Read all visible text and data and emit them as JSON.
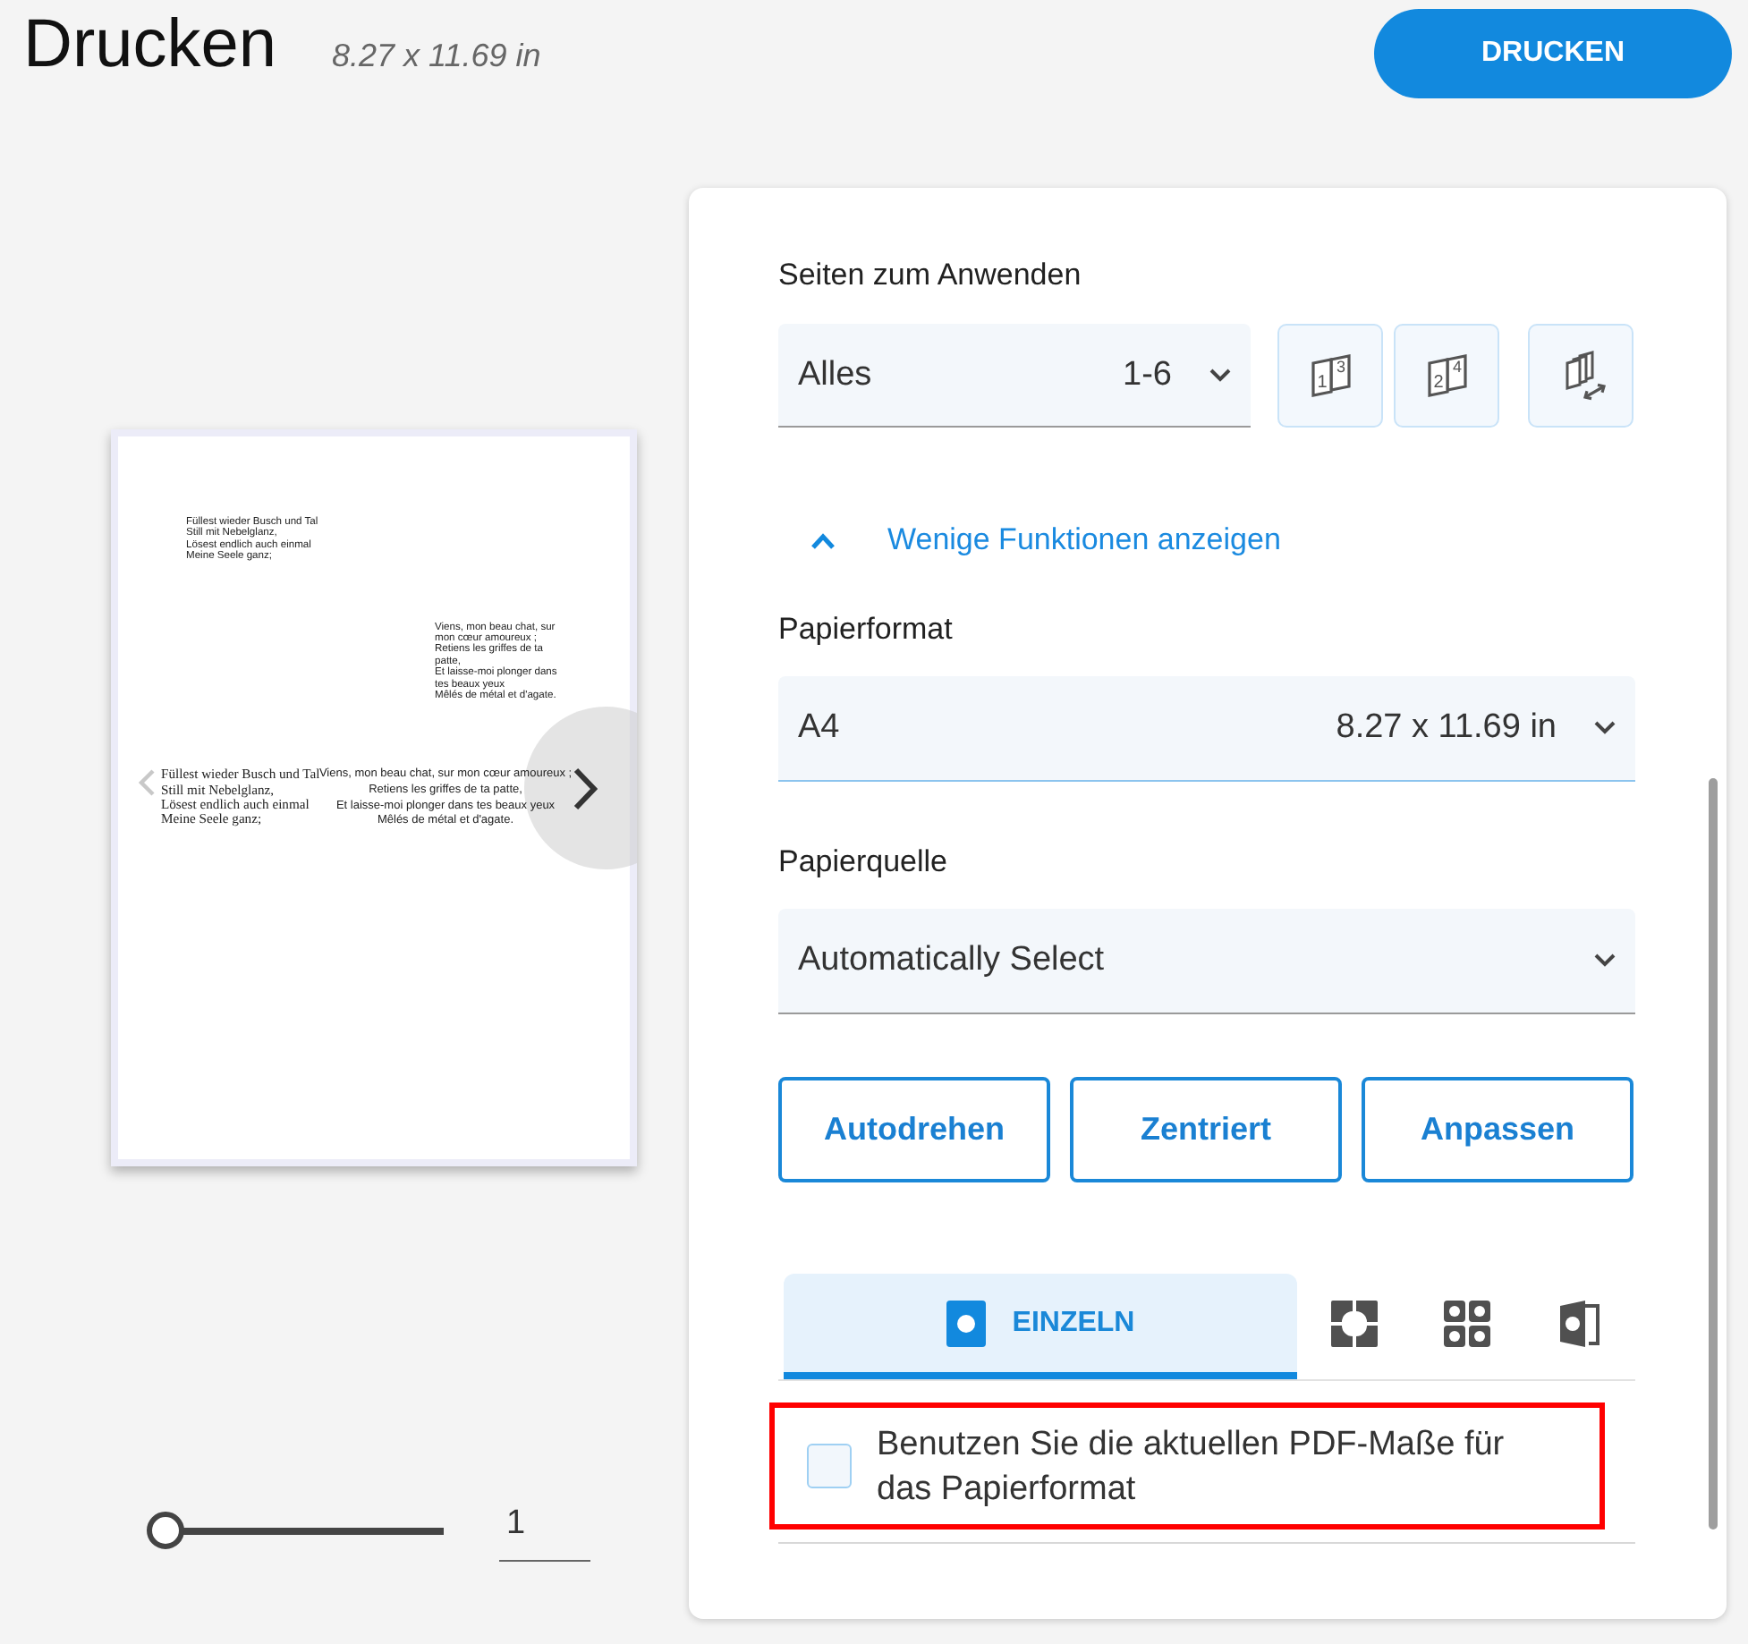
{
  "header": {
    "title": "Drucken",
    "paper_size": "8.27 x 11.69 in",
    "print_button": "DRUCKEN"
  },
  "preview": {
    "rows": [
      {
        "blocks": [
          {
            "kind": "small",
            "lines": [
              "Füllest wieder Busch und Tal",
              "Still mit Nebelglanz,",
              "Lösest endlich auch einmal",
              "Meine Seele ganz;"
            ]
          }
        ]
      },
      {
        "blocks": [
          {
            "kind": "narrow",
            "lines": [
              "Viens, mon beau chat, sur",
              "mon cœur amoureux ;",
              "Retiens les griffes de ta",
              "patte,",
              "Et laisse-moi plonger dans",
              "tes beaux yeux",
              "Mêlés de métal et d'agate."
            ]
          }
        ]
      },
      {
        "blocks": [
          {
            "kind": "serif",
            "lines": [
              "Füllest wieder Busch und Tal",
              "Still mit Nebelglanz,",
              "Lösest endlich auch einmal",
              "Meine Seele ganz;"
            ]
          },
          {
            "kind": "centered",
            "lines": [
              "Viens, mon beau chat, sur mon cœur amoureux ;",
              "Retiens les griffes de ta patte,",
              "Et laisse-moi plonger dans tes beaux yeux",
              "Mêlés de métal et d'agate."
            ]
          }
        ]
      }
    ],
    "prev_button": {
      "disabled": true
    },
    "slider": {
      "level": 0
    },
    "page_number": "1"
  },
  "settings": {
    "page_range": {
      "label": "Seiten zum Anwenden",
      "value": "Alles",
      "detail": "1-6",
      "focused": false
    },
    "page_buttons": [
      {
        "kind": "pages",
        "labels": [
          "1",
          "3"
        ]
      },
      {
        "kind": "pages",
        "labels": [
          "2",
          "4"
        ]
      },
      {
        "kind": "stack"
      }
    ],
    "toggle": {
      "label": "Wenige Funktionen anzeigen",
      "expanded": true
    },
    "paper_format": {
      "label": "Papierformat",
      "value": "A4",
      "detail": "8.27 x 11.69 in",
      "focused": true
    },
    "paper_source": {
      "label": "Papierquelle",
      "value": "Automatically Select",
      "focused": false
    },
    "layout_buttons": [
      "Autodrehen",
      "Zentriert",
      "Anpassen"
    ],
    "tabs": [
      {
        "kind": "single",
        "label": "EINZELN",
        "selected": true
      },
      {
        "kind": "tiled",
        "selected": false
      },
      {
        "kind": "grid",
        "selected": false
      },
      {
        "kind": "booklet",
        "selected": false
      }
    ],
    "pdf_size_option": {
      "label": "Benutzen Sie die aktuellen PDF-Maße für das Papierformat",
      "checked": false,
      "highlighted": true
    }
  }
}
